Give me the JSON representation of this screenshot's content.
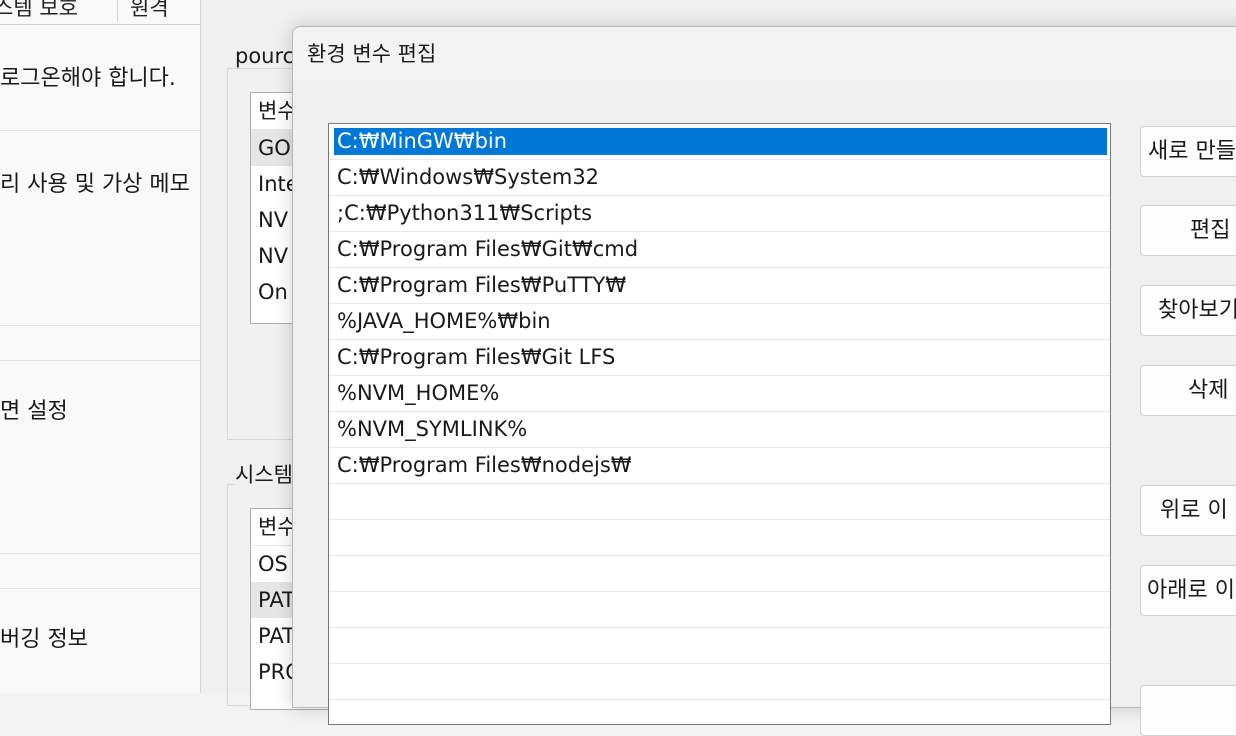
{
  "system_properties": {
    "tabs": [
      "스템 보호",
      "원격"
    ],
    "texts": [
      "로그온해야 합니다.",
      "리 사용 및 가상 메모",
      "면 설정",
      "버깅 정보"
    ]
  },
  "environment_variables": {
    "user_group_label": "pourc",
    "user_list": {
      "header": "변수",
      "rows": [
        "GO",
        "Inte",
        "NV",
        "NV",
        "On"
      ]
    },
    "system_group_label": "시스템",
    "system_list": {
      "header": "변수",
      "rows": [
        "OS",
        "PAT",
        "PAT",
        "PRO"
      ]
    }
  },
  "dialog": {
    "title": "환경 변수 편집",
    "paths": [
      "C:₩MinGW₩bin",
      "C:₩Windows₩System32",
      ";C:₩Python311₩Scripts",
      "C:₩Program Files₩Git₩cmd",
      "C:₩Program Files₩PuTTY₩",
      "%JAVA_HOME%₩bin",
      "C:₩Program Files₩Git LFS",
      "%NVM_HOME%",
      "%NVM_SYMLINK%",
      "C:₩Program Files₩nodejs₩"
    ],
    "selected_index": 0,
    "buttons": {
      "new": "새로 만들",
      "edit": "편집",
      "browse": "찾아보기",
      "delete": "삭제",
      "move_up": "위로 이",
      "move_down": "아래로 이"
    }
  }
}
